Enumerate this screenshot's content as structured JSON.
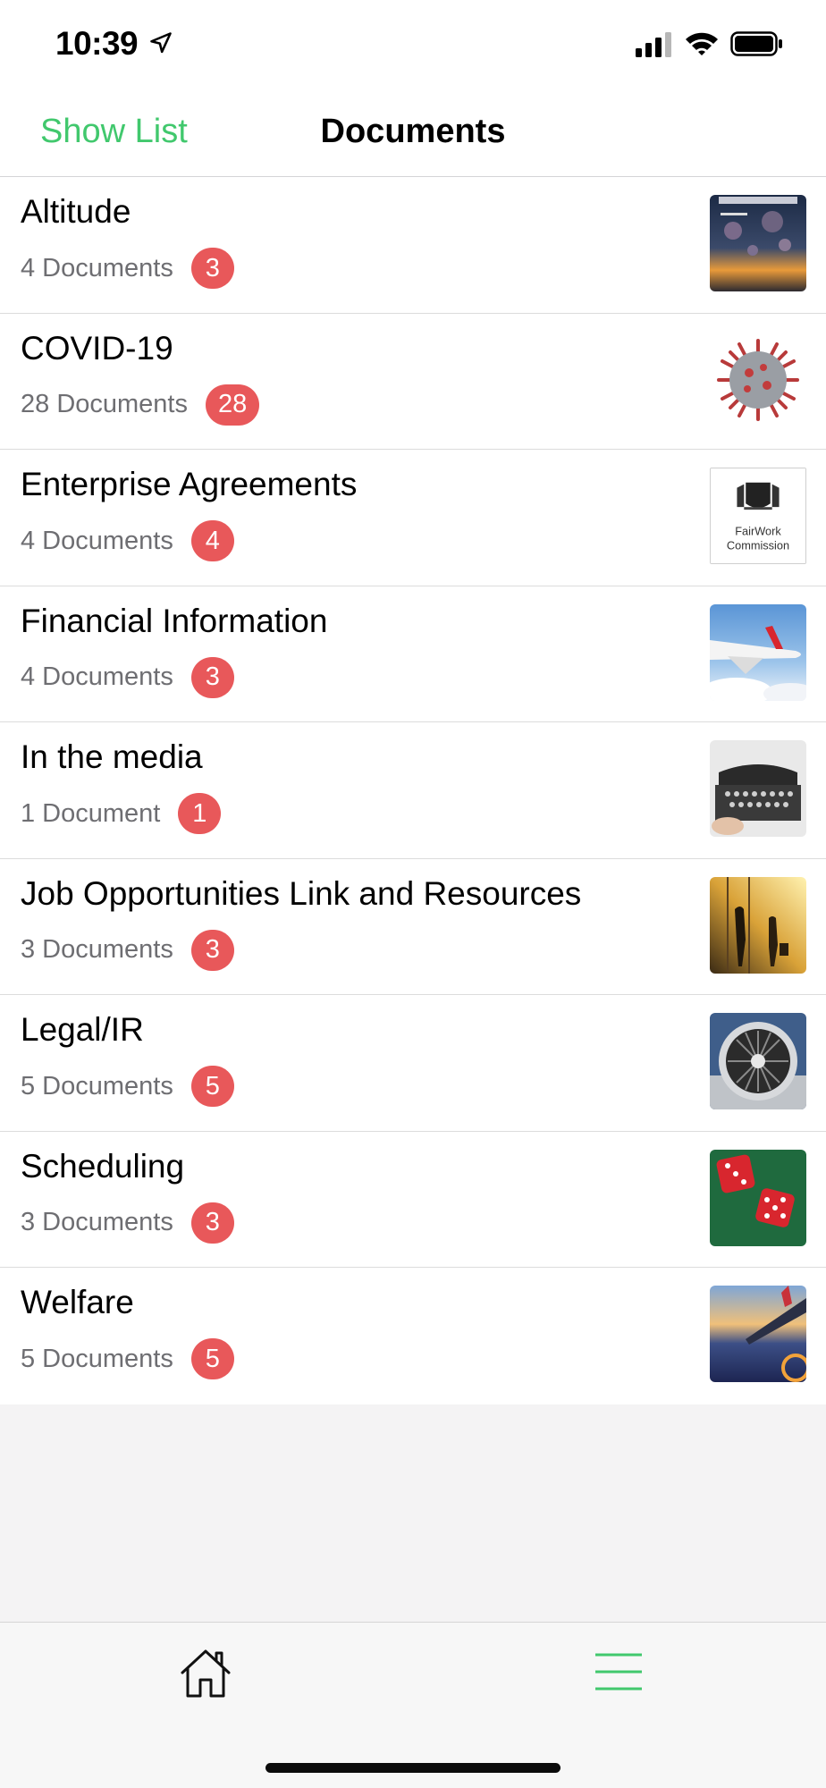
{
  "status_bar": {
    "time": "10:39"
  },
  "nav": {
    "left_button": "Show List",
    "title": "Documents"
  },
  "rows": [
    {
      "title": "Altitude",
      "count": "4 Documents",
      "badge": "3",
      "thumb_icon": "altitude-magazine-cover"
    },
    {
      "title": "COVID-19",
      "count": "28 Documents",
      "badge": "28",
      "thumb_icon": "covid-virus"
    },
    {
      "title": "Enterprise Agreements",
      "count": "4 Documents",
      "badge": "4",
      "thumb_icon": "fairwork-commission-logo",
      "thumb_text": "FairWork Commission"
    },
    {
      "title": "Financial Information",
      "count": "4 Documents",
      "badge": "3",
      "thumb_icon": "qantas-plane"
    },
    {
      "title": "In the media",
      "count": "1 Document",
      "badge": "1",
      "thumb_icon": "typewriter"
    },
    {
      "title": "Job Opportunities Link and Resources",
      "count": "3 Documents",
      "badge": "3",
      "thumb_icon": "airport-travellers"
    },
    {
      "title": "Legal/IR",
      "count": "5 Documents",
      "badge": "5",
      "thumb_icon": "jet-engine"
    },
    {
      "title": "Scheduling",
      "count": "3 Documents",
      "badge": "3",
      "thumb_icon": "red-dice"
    },
    {
      "title": "Welfare",
      "count": "5 Documents",
      "badge": "5",
      "thumb_icon": "plane-wing-sunset"
    }
  ],
  "tab_bar": {
    "home_icon": "home-icon",
    "menu_icon": "menu-icon"
  },
  "colors": {
    "accent": "#41c86d",
    "badge": "#e8585a",
    "secondary_text": "#6e6e72"
  }
}
